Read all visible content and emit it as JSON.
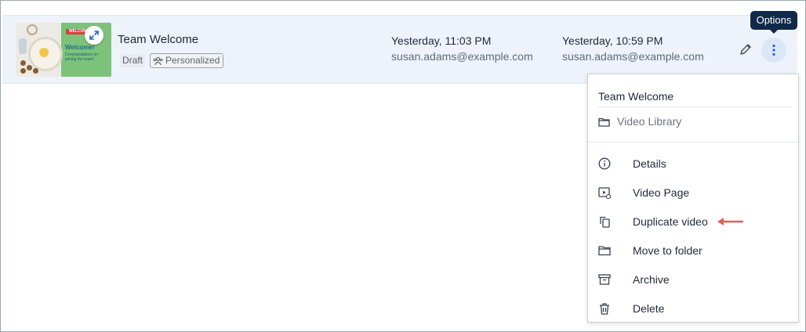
{
  "row": {
    "title": "Team Welcome",
    "status": "Draft",
    "tag": "Personalized",
    "thumbnail": {
      "banner": "WELCOME",
      "heading": "Welcome!",
      "subtext": "Congratulations on joining the team!"
    },
    "modified_date": "Yesterday, 11:03 PM",
    "modified_by": "susan.adams@example.com",
    "created_date": "Yesterday, 10:59 PM",
    "created_by": "susan.adams@example.com"
  },
  "tooltip": "Options",
  "menu": {
    "title": "Team Welcome",
    "folder": "Video Library",
    "items": [
      {
        "label": "Details",
        "icon": "info-icon"
      },
      {
        "label": "Video Page",
        "icon": "video-page-icon"
      },
      {
        "label": "Duplicate video",
        "icon": "duplicate-icon"
      },
      {
        "label": "Move to folder",
        "icon": "folder-icon"
      },
      {
        "label": "Archive",
        "icon": "archive-icon"
      },
      {
        "label": "Delete",
        "icon": "trash-icon"
      }
    ]
  },
  "colors": {
    "row_bg": "#eef2fb",
    "tooltip_bg": "#10294a",
    "options_button_bg": "#dbe6f7",
    "accent_blue": "#2563c9",
    "annotation_arrow": "#e85a5a"
  }
}
